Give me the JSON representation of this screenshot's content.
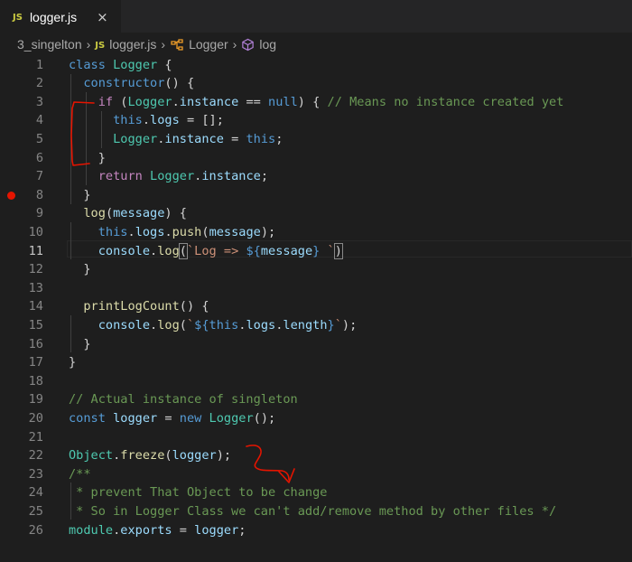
{
  "tab": {
    "badge": "JS",
    "title": "logger.js",
    "close_icon": "×"
  },
  "breadcrumb": [
    {
      "label": "3_singelton",
      "icon": ""
    },
    {
      "label": "logger.js",
      "icon": "js-file-icon"
    },
    {
      "label": "Logger",
      "icon": "class-icon"
    },
    {
      "label": "log",
      "icon": "method-icon"
    }
  ],
  "editor": {
    "breakpoint_line": 8,
    "lines": [
      {
        "n": "1",
        "tokens": [
          [
            "k",
            "class "
          ],
          [
            "c",
            "Logger"
          ],
          [
            "p",
            " {"
          ]
        ]
      },
      {
        "n": "2",
        "tokens": [
          [
            "p",
            "  "
          ],
          [
            "k",
            "constructor"
          ],
          [
            "p",
            "() {"
          ]
        ]
      },
      {
        "n": "3",
        "tokens": [
          [
            "p",
            "    "
          ],
          [
            "cf",
            "if"
          ],
          [
            "p",
            " ("
          ],
          [
            "c",
            "Logger"
          ],
          [
            "p",
            "."
          ],
          [
            "v",
            "instance"
          ],
          [
            "p",
            " == "
          ],
          [
            "k",
            "null"
          ],
          [
            "p",
            ") { "
          ],
          [
            "cm",
            "// Means no instance created yet"
          ]
        ]
      },
      {
        "n": "4",
        "tokens": [
          [
            "p",
            "      "
          ],
          [
            "k",
            "this"
          ],
          [
            "p",
            "."
          ],
          [
            "v",
            "logs"
          ],
          [
            "p",
            " = [];"
          ]
        ]
      },
      {
        "n": "5",
        "tokens": [
          [
            "p",
            "      "
          ],
          [
            "c",
            "Logger"
          ],
          [
            "p",
            "."
          ],
          [
            "v",
            "instance"
          ],
          [
            "p",
            " = "
          ],
          [
            "k",
            "this"
          ],
          [
            "p",
            ";"
          ]
        ]
      },
      {
        "n": "6",
        "tokens": [
          [
            "p",
            "    }"
          ]
        ]
      },
      {
        "n": "7",
        "tokens": [
          [
            "p",
            "    "
          ],
          [
            "cf",
            "return"
          ],
          [
            "p",
            " "
          ],
          [
            "c",
            "Logger"
          ],
          [
            "p",
            "."
          ],
          [
            "v",
            "instance"
          ],
          [
            "p",
            ";"
          ]
        ]
      },
      {
        "n": "8",
        "tokens": [
          [
            "p",
            "  }"
          ]
        ]
      },
      {
        "n": "9",
        "tokens": [
          [
            "p",
            "  "
          ],
          [
            "f",
            "log"
          ],
          [
            "p",
            "("
          ],
          [
            "v",
            "message"
          ],
          [
            "p",
            ") {"
          ]
        ]
      },
      {
        "n": "10",
        "tokens": [
          [
            "p",
            "    "
          ],
          [
            "k",
            "this"
          ],
          [
            "p",
            "."
          ],
          [
            "v",
            "logs"
          ],
          [
            "p",
            "."
          ],
          [
            "f",
            "push"
          ],
          [
            "p",
            "("
          ],
          [
            "v",
            "message"
          ],
          [
            "p",
            ");"
          ]
        ]
      },
      {
        "n": "11",
        "tokens": [
          [
            "p",
            "    "
          ],
          [
            "v",
            "console"
          ],
          [
            "p",
            "."
          ],
          [
            "f",
            "log"
          ],
          [
            "p",
            "("
          ],
          [
            "s",
            "`Log => "
          ],
          [
            "k",
            "${"
          ],
          [
            "v",
            "message"
          ],
          [
            "k",
            "}"
          ],
          [
            "s",
            " `"
          ],
          [
            "p",
            ")"
          ]
        ]
      },
      {
        "n": "12",
        "tokens": [
          [
            "p",
            "  }"
          ]
        ]
      },
      {
        "n": "13",
        "tokens": []
      },
      {
        "n": "14",
        "tokens": [
          [
            "p",
            "  "
          ],
          [
            "f",
            "printLogCount"
          ],
          [
            "p",
            "() {"
          ]
        ]
      },
      {
        "n": "15",
        "tokens": [
          [
            "p",
            "    "
          ],
          [
            "v",
            "console"
          ],
          [
            "p",
            "."
          ],
          [
            "f",
            "log"
          ],
          [
            "p",
            "("
          ],
          [
            "s",
            "`"
          ],
          [
            "k",
            "${"
          ],
          [
            "k",
            "this"
          ],
          [
            "p",
            "."
          ],
          [
            "v",
            "logs"
          ],
          [
            "p",
            "."
          ],
          [
            "v",
            "length"
          ],
          [
            "k",
            "}"
          ],
          [
            "s",
            "`"
          ],
          [
            "p",
            ");"
          ]
        ]
      },
      {
        "n": "16",
        "tokens": [
          [
            "p",
            "  }"
          ]
        ]
      },
      {
        "n": "17",
        "tokens": [
          [
            "p",
            "}"
          ]
        ]
      },
      {
        "n": "18",
        "tokens": []
      },
      {
        "n": "19",
        "tokens": [
          [
            "cm",
            "// Actual instance of singleton"
          ]
        ]
      },
      {
        "n": "20",
        "tokens": [
          [
            "k",
            "const "
          ],
          [
            "v",
            "logger"
          ],
          [
            "p",
            " = "
          ],
          [
            "k",
            "new "
          ],
          [
            "c",
            "Logger"
          ],
          [
            "p",
            "();"
          ]
        ]
      },
      {
        "n": "21",
        "tokens": []
      },
      {
        "n": "22",
        "tokens": [
          [
            "c",
            "Object"
          ],
          [
            "p",
            "."
          ],
          [
            "f",
            "freeze"
          ],
          [
            "p",
            "("
          ],
          [
            "v",
            "logger"
          ],
          [
            "p",
            ");"
          ]
        ]
      },
      {
        "n": "23",
        "tokens": [
          [
            "cm",
            "/**"
          ]
        ]
      },
      {
        "n": "24",
        "tokens": [
          [
            "cm",
            " * prevent That Object to be change"
          ]
        ]
      },
      {
        "n": "25",
        "tokens": [
          [
            "cm",
            " * So in Logger Class we can't add/remove method by other files */"
          ]
        ]
      },
      {
        "n": "26",
        "tokens": [
          [
            "c",
            "module"
          ],
          [
            "p",
            "."
          ],
          [
            "v",
            "exports"
          ],
          [
            "p",
            " = "
          ],
          [
            "v",
            "logger"
          ],
          [
            "p",
            ";"
          ]
        ]
      }
    ]
  },
  "colors": {
    "background": "#1e1e1e",
    "keyword": "#569cd6",
    "class": "#4ec9b0",
    "function": "#dcdcaa",
    "variable": "#9cdcfe",
    "control": "#c586c0",
    "string": "#ce9178",
    "comment": "#6a9955",
    "annotation": "#e51400"
  }
}
